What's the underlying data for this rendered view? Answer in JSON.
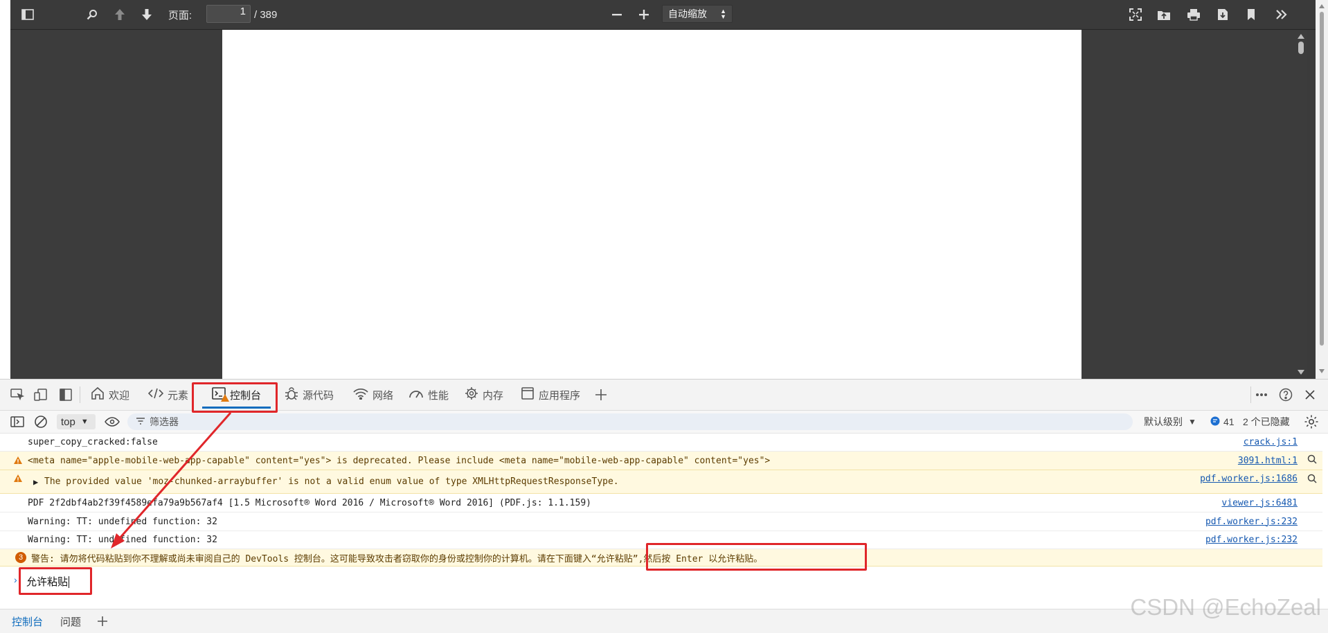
{
  "pdf_viewer": {
    "page_label": "页面:",
    "page_current": "1",
    "page_total": "/ 389",
    "zoom_value": "自动缩放"
  },
  "devtools": {
    "tabs": [
      {
        "label": "欢迎",
        "icon": "home-icon"
      },
      {
        "label": "元素",
        "icon": "code-icon"
      },
      {
        "label": "控制台",
        "icon": "console-icon",
        "active": true
      },
      {
        "label": "源代码",
        "icon": "bug-icon"
      },
      {
        "label": "网络",
        "icon": "wifi-icon"
      },
      {
        "label": "性能",
        "icon": "gauge-icon"
      },
      {
        "label": "内存",
        "icon": "chip-icon"
      },
      {
        "label": "应用程序",
        "icon": "app-icon"
      }
    ],
    "console_toolbar": {
      "context": "top",
      "filter_placeholder": "筛选器",
      "level": "默认级别",
      "message_count": "41",
      "hidden_count": "2 个已隐藏"
    },
    "log": [
      {
        "type": "log",
        "text": "super_copy_cracked:false",
        "source": "crack.js:1"
      },
      {
        "type": "warn",
        "text": "<meta name=\"apple-mobile-web-app-capable\" content=\"yes\"> is deprecated. Please include <meta name=\"mobile-web-app-capable\" content=\"yes\">",
        "source": "3091.html:1"
      },
      {
        "type": "warn",
        "text": "The provided value 'moz-chunked-arraybuffer' is not a valid enum value of type XMLHttpRequestResponseType.",
        "source": "pdf.worker.js:1686",
        "expandable": true
      },
      {
        "type": "log",
        "text": "PDF 2f2dbf4ab2f39f4589efa79a9b567af4 [1.5 Microsoft® Word 2016 / Microsoft® Word 2016] (PDF.js: 1.1.159)",
        "source": "viewer.js:6481"
      },
      {
        "type": "log",
        "text": "Warning: TT: undefined function: 32",
        "source": "pdf.worker.js:232"
      },
      {
        "type": "log",
        "text": "Warning: TT: undefined function: 32",
        "source": "pdf.worker.js:232"
      },
      {
        "type": "warn-count",
        "count": "3",
        "text": "警告: 请勿将代码粘贴到你不理解或尚未审阅自己的 DevTools 控制台。这可能导致攻击者窃取你的身份或控制你的计算机。请在下面键入“允许粘贴”,然后按 Enter 以允许粘贴。"
      }
    ],
    "console_input": "允许粘贴",
    "drawer_tabs": [
      "控制台",
      "问题"
    ]
  },
  "watermark": "CSDN @EchoZeal",
  "colors": {
    "annotation_red": "#e0262a",
    "active_tab_blue": "#0f6cbd",
    "warn_background": "#fff9e0"
  }
}
